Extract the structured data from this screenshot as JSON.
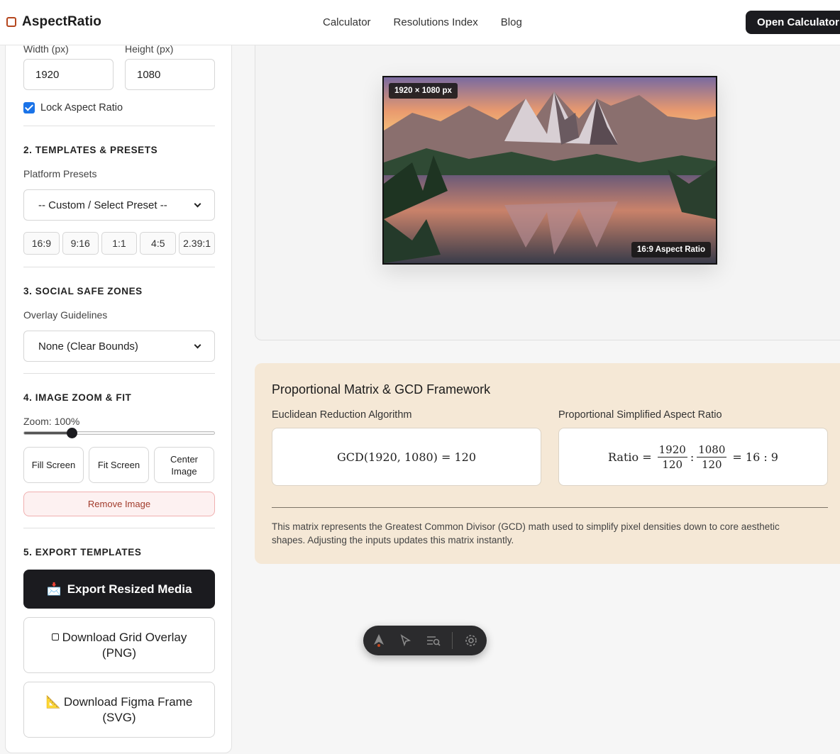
{
  "header": {
    "brand": "AspectRatio",
    "nav": [
      "Calculator",
      "Resolutions Index",
      "Blog"
    ],
    "cta": "Open Calculator"
  },
  "dimensions": {
    "width_label": "Width (px)",
    "height_label": "Height (px)",
    "width_value": "1920",
    "height_value": "1080",
    "lock_label": "Lock Aspect Ratio",
    "lock_checked": true
  },
  "templates": {
    "title": "2. TEMPLATES & PRESETS",
    "presets_label": "Platform Presets",
    "presets_selected": "-- Custom / Select Preset --",
    "ratios": [
      "16:9",
      "9:16",
      "1:1",
      "4:5",
      "2.39:1"
    ]
  },
  "safe_zones": {
    "title": "3. SOCIAL SAFE ZONES",
    "label": "Overlay Guidelines",
    "selected": "None (Clear Bounds)"
  },
  "zoom": {
    "title": "4. IMAGE ZOOM & FIT",
    "label": "Zoom: 100%",
    "slider_fraction": 0.25,
    "fill": "Fill Screen",
    "fit": "Fit Screen",
    "center": "Center Image",
    "remove": "Remove Image"
  },
  "export": {
    "title": "5. EXPORT TEMPLATES",
    "resized_icon": "📩",
    "resized": "Export Resized Media",
    "grid": "Download Grid Overlay (PNG)",
    "figma_icon": "📐",
    "figma": "Download Figma Frame (SVG)"
  },
  "preview": {
    "size_badge": "1920 × 1080 px",
    "ratio_badge": "16:9 Aspect Ratio"
  },
  "matrix": {
    "title": "Proportional Matrix & GCD Framework",
    "gcd_label": "Euclidean Reduction Algorithm",
    "ratio_label": "Proportional Simplified Aspect Ratio",
    "gcd_expr": "GCD(1920, 1080) = 120",
    "ratio_word": "Ratio =",
    "num_w": "1920",
    "num_h": "1080",
    "den": "120",
    "result": "= 16 : 9",
    "note": "This matrix represents the Greatest Common Divisor (GCD) math used to simplify pixel densities down to core aesthetic shapes. Adjusting the inputs updates this matrix instantly."
  },
  "colors": {
    "brand_accent": "#b5471f",
    "dark": "#1b1b1f",
    "matrix_bg": "#f5e8d6",
    "danger": "#a13b2b"
  },
  "toolbar_icons": [
    "astro-icon",
    "cursor-icon",
    "audit-icon",
    "gear-icon"
  ]
}
